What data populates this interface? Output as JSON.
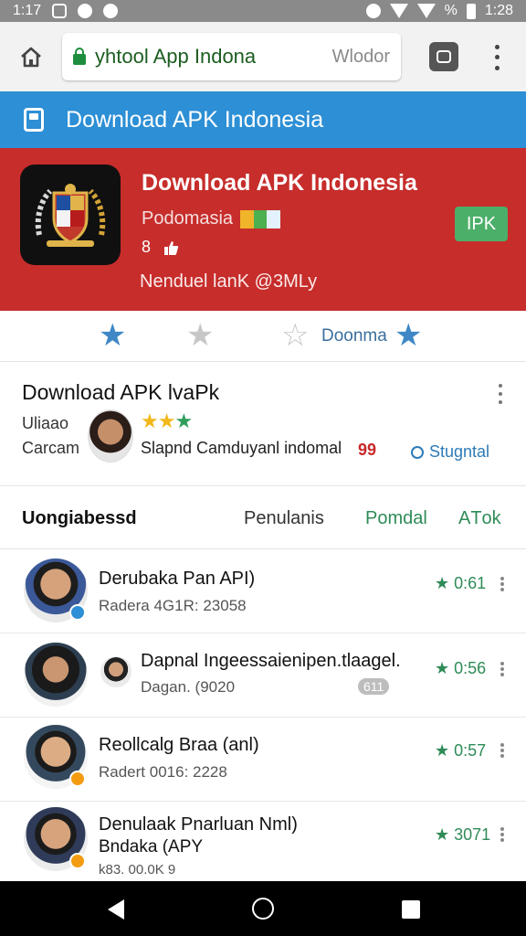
{
  "status_bar": {
    "time": "1:17",
    "battery_text": "%",
    "right_time": "1:28"
  },
  "browser": {
    "url_text": "yhtool App  Indona",
    "url_hint": "Wlodor"
  },
  "site_header": {
    "title": "Download APK Indonesia"
  },
  "hero": {
    "title": "Download APK Indonesia",
    "developer": "Podomasia",
    "meta": "8",
    "subtitle": "Nenduel lanK @3MLy",
    "install_label": "IPK",
    "colors": {
      "background": "#c62d2b",
      "button": "#4caf69"
    }
  },
  "rating_row": {
    "label": "Doonma",
    "star_color_active": "#3f88c5",
    "star_color_inactive": "#c7c7c7"
  },
  "details": {
    "title": "Download APK lvaPk",
    "label_1": "Uliaao",
    "label_2": "Carcam",
    "description": "Slapnd Camduyanl indomal",
    "count": "99",
    "link_text": "Stugntal"
  },
  "tabs": [
    "Uongiabessd",
    "Penulanis",
    "Pomdal",
    "AТok"
  ],
  "list": [
    {
      "title": "Derubaka Pan API)",
      "subtitle": "Radera 4G1R: 23058",
      "score": "0:61"
    },
    {
      "title": "Dapnal Ingeessaienipen.tlaagel.",
      "subtitle": "Dagan. (9020",
      "score": "0:56",
      "tag": "611"
    },
    {
      "title": "Reollcalg Braa (anl)",
      "subtitle": "Radert 0016: 2228",
      "score": "0:57"
    },
    {
      "title": "Denulaak Pnarluan Nml)",
      "subtitle": "Bndaka (APY",
      "extra": "k83.  00.0K  9",
      "score": "3071"
    }
  ]
}
